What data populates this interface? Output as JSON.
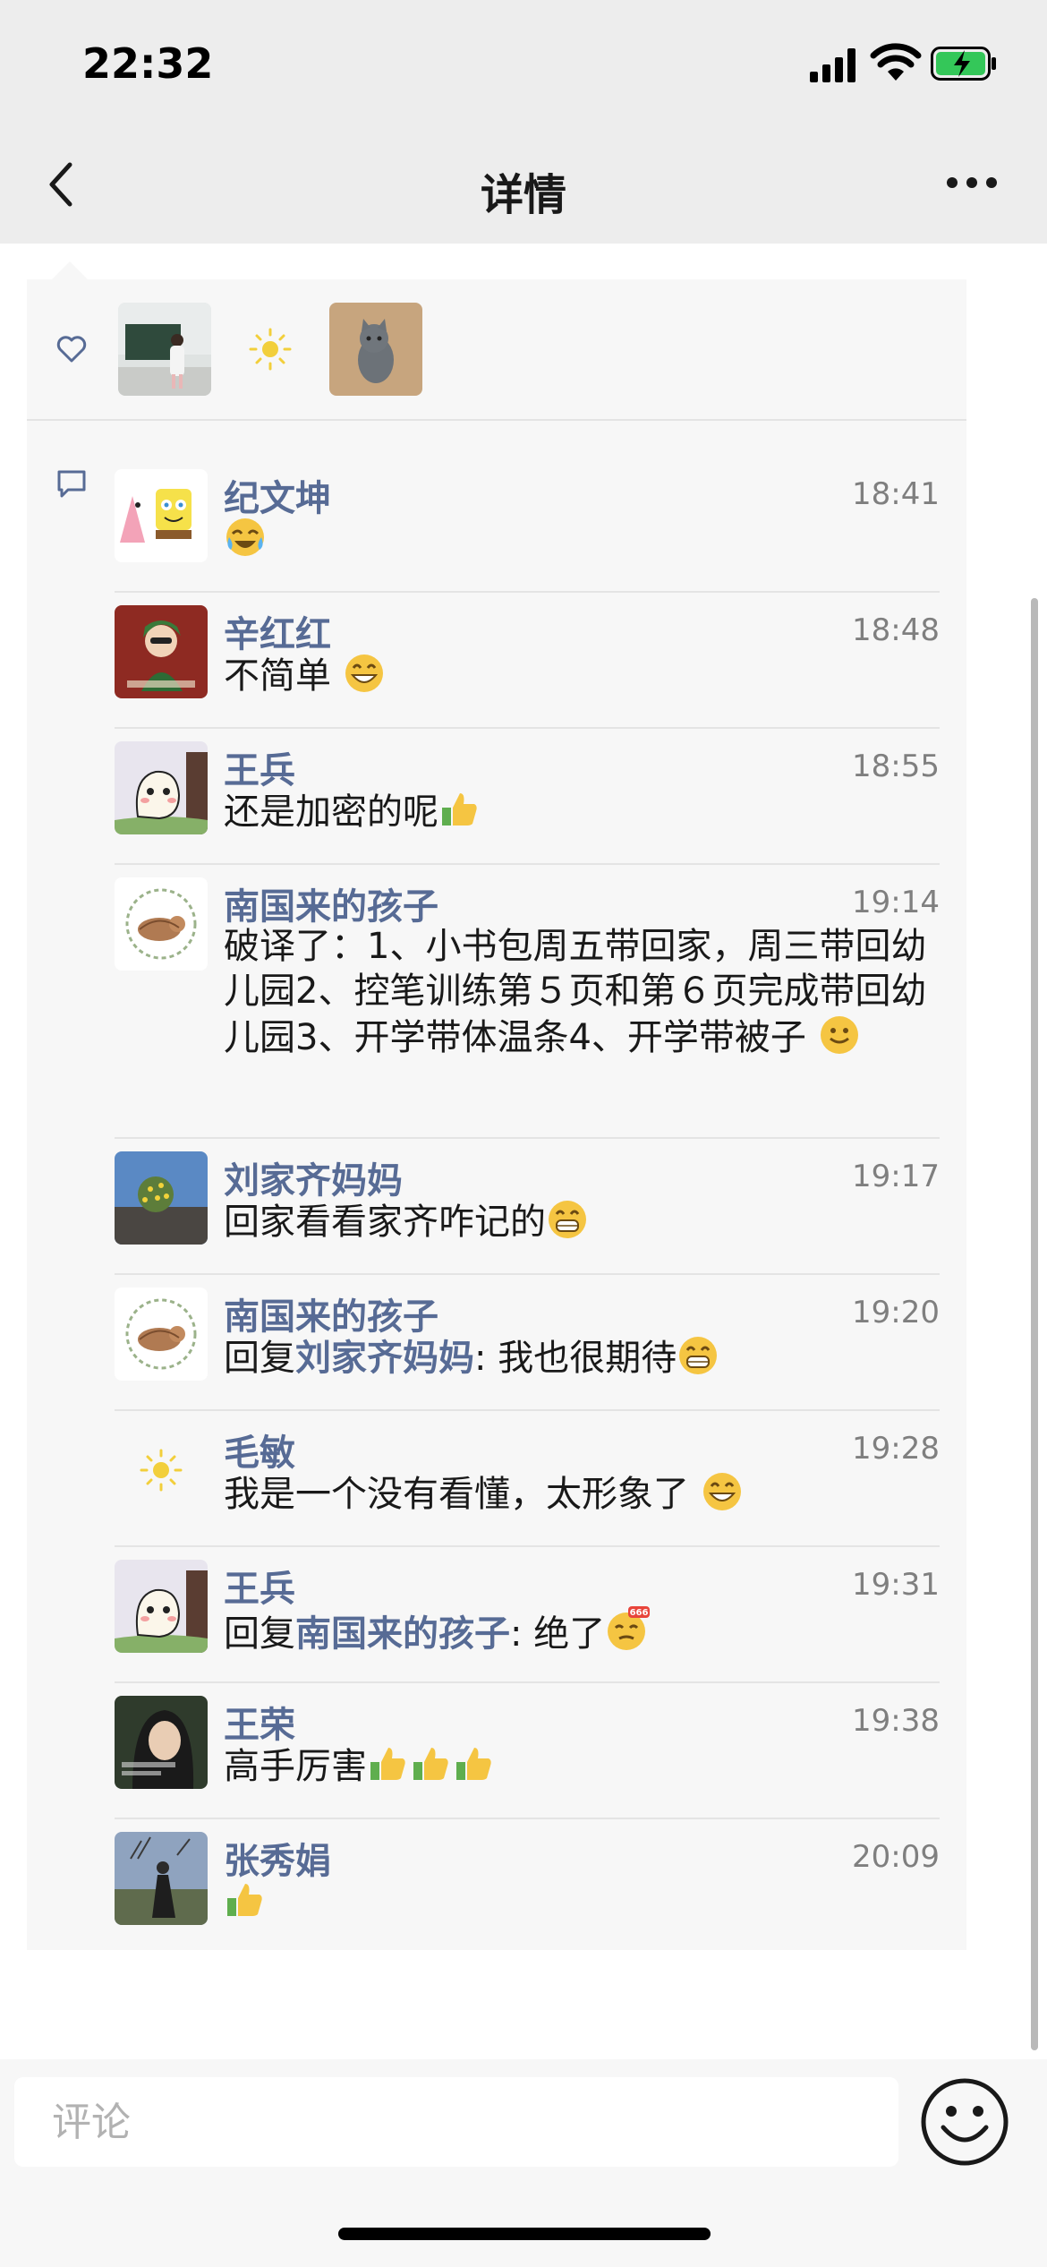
{
  "status_bar": {
    "time": "22:32"
  },
  "nav": {
    "title": "详情"
  },
  "likes": [
    {
      "name": "photo-classroom"
    },
    {
      "name": "sun-avatar"
    },
    {
      "name": "kitten-photo"
    }
  ],
  "comments": [
    {
      "name": "纪文坤",
      "time": "18:41",
      "text": "",
      "emoji": "laugh-cry"
    },
    {
      "name": "辛红红",
      "time": "18:48",
      "text": "不简单",
      "emoji": "grin"
    },
    {
      "name": "王兵",
      "time": "18:55",
      "text": "还是加密的呢",
      "emoji": "thumbs-up"
    },
    {
      "name": "南国来的孩子",
      "time": "19:14",
      "text": "破译了：1、小书包周五带回家，周三带回幼儿园2、控笔训练第５页和第６页完成带回幼儿园3、开学带体温条4、开学带被子",
      "emoji": "smile"
    },
    {
      "name": "刘家齐妈妈",
      "time": "19:17",
      "text": "回家看看家齐咋记的",
      "emoji": "grin-teeth"
    },
    {
      "name": "南国来的孩子",
      "time": "19:20",
      "reply_prefix": "回复",
      "reply_to": "刘家齐妈妈",
      "text": ": 我也很期待",
      "emoji": "grin-teeth"
    },
    {
      "name": "毛敏",
      "time": "19:28",
      "text": "我是一个没有看懂，太形象了",
      "emoji": "grin"
    },
    {
      "name": "王兵",
      "time": "19:31",
      "reply_prefix": "回复",
      "reply_to": "南国来的孩子",
      "text": ": 绝了",
      "emoji": "666"
    },
    {
      "name": "王荣",
      "time": "19:38",
      "text": "高手厉害",
      "emoji": "thumbs-up-x3"
    },
    {
      "name": "张秀娟",
      "time": "20:09",
      "text": "",
      "emoji": "thumbs-up"
    }
  ],
  "input": {
    "placeholder": "评论"
  },
  "colors": {
    "name_link": "#576b95",
    "panel_bg": "#f7f7f7",
    "nav_bg": "#ededed"
  },
  "icons": [
    "back-chevron",
    "more-dots",
    "heart-outline",
    "comment-bubble",
    "smiley-face"
  ]
}
